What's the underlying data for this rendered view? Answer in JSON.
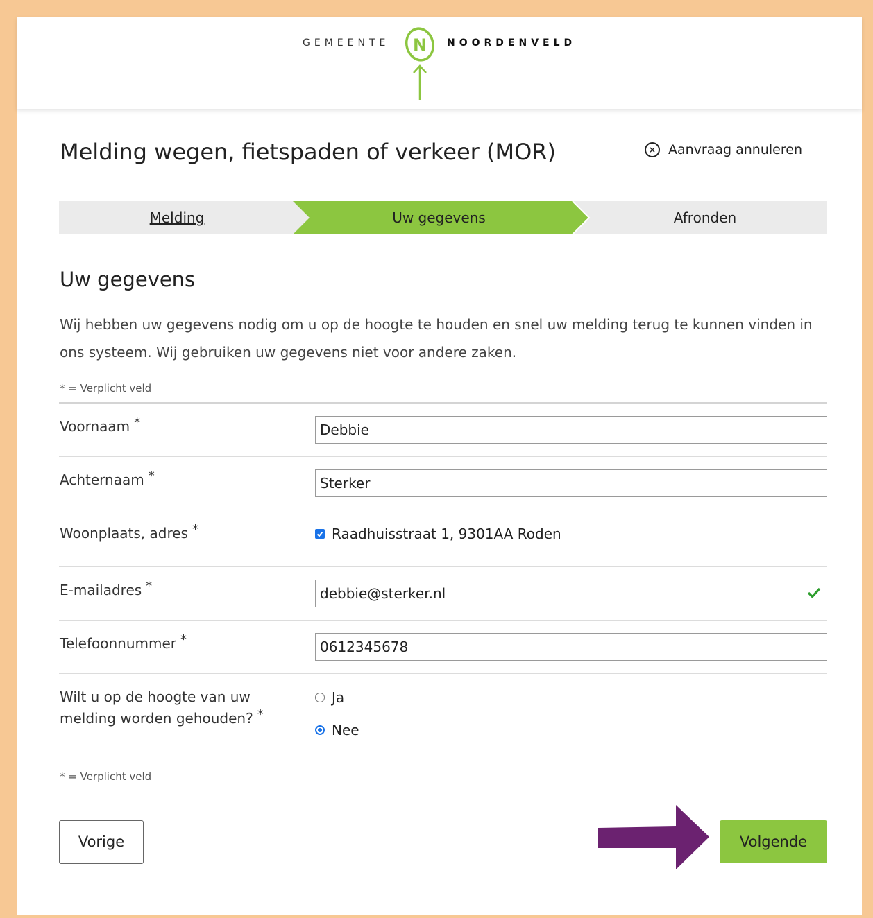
{
  "brand": {
    "left_text": "GEMEENTE",
    "right_text": "NOORDENVELD",
    "logo_letter": "N",
    "green": "#8cc640",
    "frame_color": "#f7c894"
  },
  "header": {
    "title": "Melding wegen, fietspaden of verkeer (MOR)",
    "cancel_label": "Aanvraag annuleren"
  },
  "steps": [
    {
      "label": "Melding",
      "state": "completed"
    },
    {
      "label": "Uw gegevens",
      "state": "active"
    },
    {
      "label": "Afronden",
      "state": "upcoming"
    }
  ],
  "section": {
    "title": "Uw gegevens",
    "intro": "Wij hebben uw gegevens nodig om u op de hoogte te houden en snel uw melding terug te kunnen vinden in ons systeem. Wij gebruiken uw gegevens niet voor andere zaken.",
    "required_note": "* = Verplicht veld"
  },
  "fields": {
    "first_name": {
      "label": "Voornaam",
      "value": "Debbie"
    },
    "last_name": {
      "label": "Achternaam",
      "value": "Sterker"
    },
    "address": {
      "label": "Woonplaats, adres",
      "value": "Raadhuisstraat 1, 9301AA Roden",
      "checked": true
    },
    "email": {
      "label": "E-mailadres",
      "value": "debbie@sterker.nl"
    },
    "phone": {
      "label": "Telefoonnummer",
      "value": "0612345678"
    },
    "keep_informed": {
      "label_line1": "Wilt u op de hoogte van uw",
      "label_line2": "melding worden gehouden?",
      "options": [
        "Ja",
        "Nee"
      ],
      "selected": "Nee"
    },
    "required_star": "*"
  },
  "buttons": {
    "previous": "Vorige",
    "next": "Volgende"
  },
  "annotation": {
    "arrow_color": "#6b2270"
  }
}
